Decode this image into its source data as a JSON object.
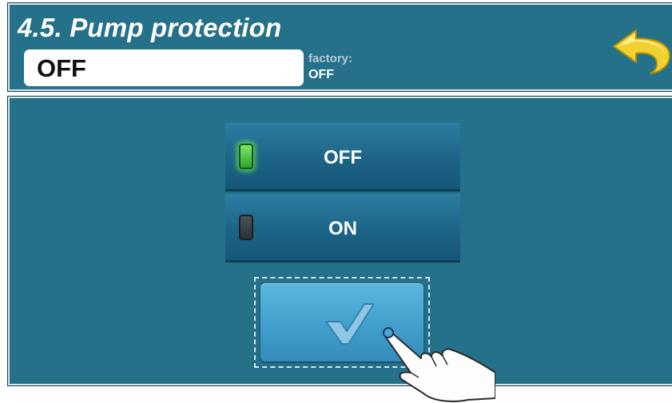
{
  "header": {
    "title": "4.5. Pump protection",
    "current_value": "OFF",
    "factory_label": "factory:",
    "factory_value": "OFF"
  },
  "options": [
    {
      "label": "OFF",
      "selected": true
    },
    {
      "label": "ON",
      "selected": false
    }
  ],
  "icons": {
    "back": "back-arrow-icon",
    "confirm": "checkmark-icon",
    "indicator_on": "led-green-icon",
    "indicator_off": "led-dark-icon",
    "pointer": "hand-pointer-icon"
  },
  "colors": {
    "panel": "#247189",
    "option": "#1c6487",
    "confirm": "#4ba6d2",
    "back_arrow": "#f2d230",
    "led_on": "#5fd04a"
  }
}
